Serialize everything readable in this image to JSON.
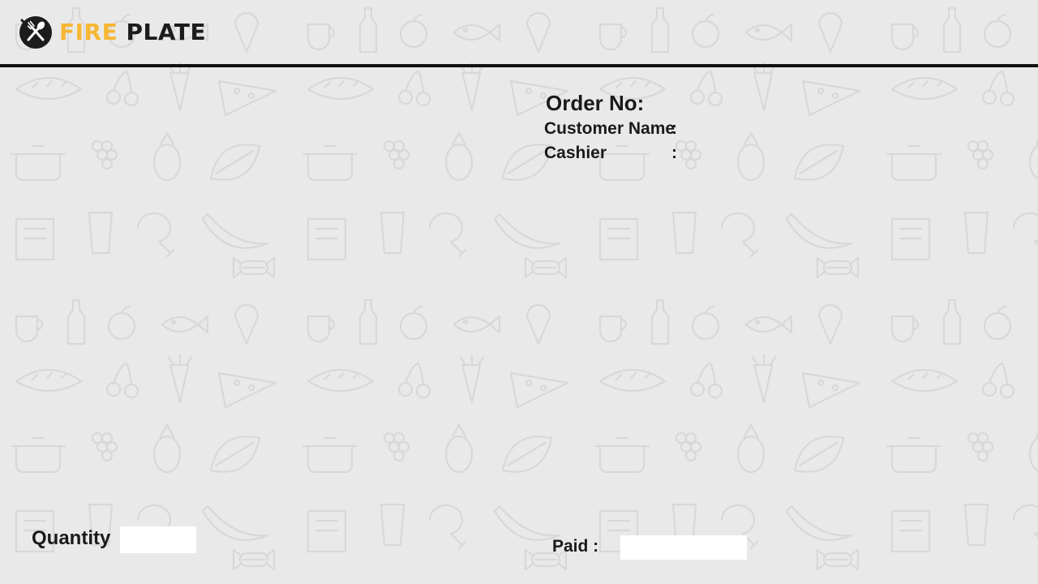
{
  "app": {
    "brand_part1": "FIRE",
    "brand_part2": "PLATE",
    "logo_icon": "crossed-fork-spoon-icon",
    "brand_accent_color": "#f7b733",
    "brand_dark_color": "#1c1c1c"
  },
  "order": {
    "title": "Order No:",
    "number": "",
    "customer_label": "Customer Name",
    "customer_name": "",
    "cashier_label": "Cashier",
    "cashier_name": "",
    "separator": ":"
  },
  "footer": {
    "quantity_label": "Quantity",
    "quantity_value": "",
    "paid_label": "Paid  :",
    "paid_value": ""
  }
}
